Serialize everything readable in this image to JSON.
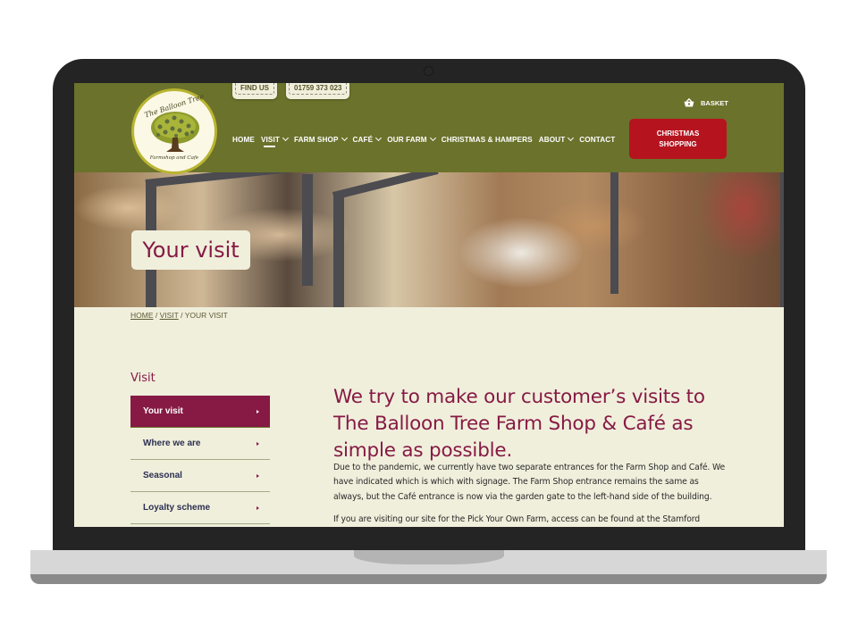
{
  "header": {
    "top_links": [
      "FIND US",
      "01759 373 023"
    ],
    "logo": {
      "title": "The Balloon Tree",
      "subtitle": "Farmshop and Cafe"
    },
    "nav": [
      {
        "label": "HOME",
        "dropdown": false,
        "active": false
      },
      {
        "label": "VISIT",
        "dropdown": true,
        "active": true
      },
      {
        "label": "FARM SHOP",
        "dropdown": true,
        "active": false
      },
      {
        "label": "CAFÉ",
        "dropdown": true,
        "active": false
      },
      {
        "label": "OUR FARM",
        "dropdown": true,
        "active": false
      },
      {
        "label": "CHRISTMAS & HAMPERS",
        "dropdown": false,
        "active": false
      },
      {
        "label": "ABOUT",
        "dropdown": true,
        "active": false
      },
      {
        "label": "CONTACT",
        "dropdown": false,
        "active": false
      }
    ],
    "basket_label": "BASKET",
    "cta_line1": "CHRISTMAS",
    "cta_line2": "SHOPPING"
  },
  "hero": {
    "title": "Your visit"
  },
  "breadcrumb": {
    "items": [
      "HOME",
      "VISIT",
      "YOUR VISIT"
    ],
    "separator": "/"
  },
  "sidebar": {
    "title": "Visit",
    "items": [
      {
        "label": "Your visit",
        "active": true
      },
      {
        "label": "Where we are",
        "active": false
      },
      {
        "label": "Seasonal",
        "active": false
      },
      {
        "label": "Loyalty scheme",
        "active": false
      }
    ]
  },
  "main": {
    "heading": "We try to make our customer’s visits to The Balloon Tree Farm Shop & Café as simple as possible.",
    "paragraphs": [
      "Due to the pandemic, we currently have two separate entrances for the Farm Shop and Café. We have indicated which is which with signage. The Farm Shop entrance remains the same as always, but the Café entrance is now via the garden gate to the left-hand side of the building.",
      "If you are visiting our site for the Pick Your Own Farm, access can be found at the Stamford"
    ]
  },
  "colors": {
    "header_green": "#6b722b",
    "brand_maroon": "#861a44",
    "cta_red": "#b5141f",
    "page_cream": "#f0efdc",
    "sidebar_text_navy": "#2b2f51"
  }
}
